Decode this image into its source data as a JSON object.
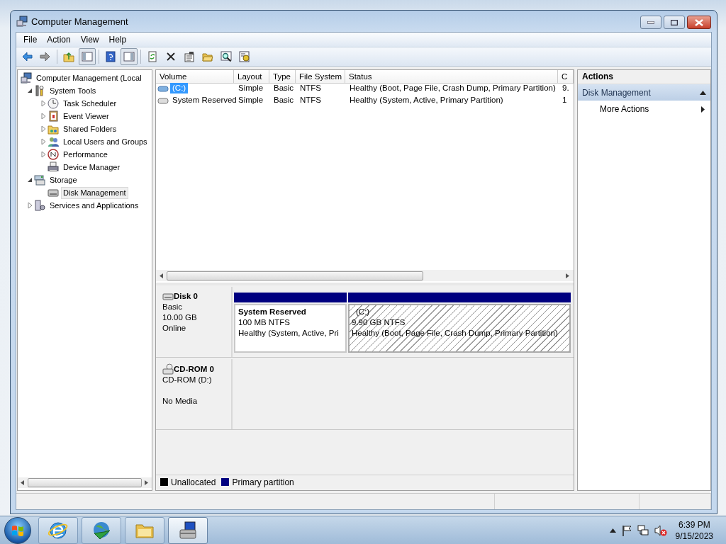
{
  "window": {
    "title": "Computer Management"
  },
  "menu": [
    {
      "label": "File"
    },
    {
      "label": "Action"
    },
    {
      "label": "View"
    },
    {
      "label": "Help"
    }
  ],
  "toolbar": [
    {
      "pressed": false
    },
    {
      "pressed": false
    },
    {
      "pressed": false
    },
    {
      "pressed": true
    },
    {
      "pressed": false
    },
    {
      "pressed": true
    },
    {
      "pressed": false
    },
    {
      "pressed": false
    },
    {
      "pressed": false
    },
    {
      "pressed": false
    },
    {
      "pressed": false
    },
    {
      "pressed": false
    }
  ],
  "tree": {
    "items": [
      {
        "label": "Computer Management (Local",
        "selected": false,
        "children": [
          {
            "label": "System Tools",
            "expanded": true,
            "selected": false,
            "children": [
              {
                "label": "Task Scheduler",
                "expanded": false,
                "selected": false
              },
              {
                "label": "Event Viewer",
                "expanded": false,
                "selected": false
              },
              {
                "label": "Shared Folders",
                "expanded": false,
                "selected": false
              },
              {
                "label": "Local Users and Groups",
                "expanded": false,
                "selected": false
              },
              {
                "label": "Performance",
                "expanded": false,
                "selected": false
              },
              {
                "label": "Device Manager",
                "selected": false
              }
            ]
          },
          {
            "label": "Storage",
            "expanded": true,
            "selected": false,
            "children": [
              {
                "label": "Disk Management",
                "selected": true
              }
            ]
          },
          {
            "label": "Services and Applications",
            "expanded": false,
            "selected": false
          }
        ]
      }
    ]
  },
  "volumes": {
    "columns": [
      "Volume",
      "Layout",
      "Type",
      "File System",
      "Status",
      "C"
    ],
    "rows": [
      {
        "selected": true,
        "cells": [
          "(C:)",
          "Simple",
          "Basic",
          "NTFS",
          "Healthy (Boot, Page File, Crash Dump, Primary Partition)",
          "9."
        ]
      },
      {
        "selected": false,
        "cells": [
          "System Reserved",
          "Simple",
          "Basic",
          "NTFS",
          "Healthy (System, Active, Primary Partition)",
          "1"
        ]
      }
    ]
  },
  "disks": [
    {
      "kind": "disk",
      "name": "Disk 0",
      "type": "Basic",
      "size": "10.00 GB",
      "status": "Online",
      "partitions": [
        {
          "name": "System Reserved",
          "size": "100 MB NTFS",
          "status": "Healthy (System, Active, Pri",
          "selected": false
        },
        {
          "name": "(C:)",
          "size": "9.90 GB NTFS",
          "status": "Healthy (Boot, Page File, Crash Dump, Primary Partition)",
          "selected": true
        }
      ]
    },
    {
      "kind": "cdrom",
      "name": "CD-ROM 0",
      "type": "CD-ROM (D:)",
      "status": "No Media"
    }
  ],
  "legend": [
    {
      "label": "Unallocated",
      "color": "#000000"
    },
    {
      "label": "Primary partition",
      "color": "#000080"
    }
  ],
  "actions": {
    "title": "Actions",
    "sections": [
      {
        "title": "Disk Management",
        "expanded": true,
        "items": [
          {
            "label": "More Actions"
          }
        ]
      }
    ]
  },
  "taskbar": {
    "apps": [
      {
        "active": false
      },
      {
        "active": false
      },
      {
        "active": false
      },
      {
        "active": true
      }
    ],
    "time": "6:39 PM",
    "date": "9/15/2023"
  }
}
